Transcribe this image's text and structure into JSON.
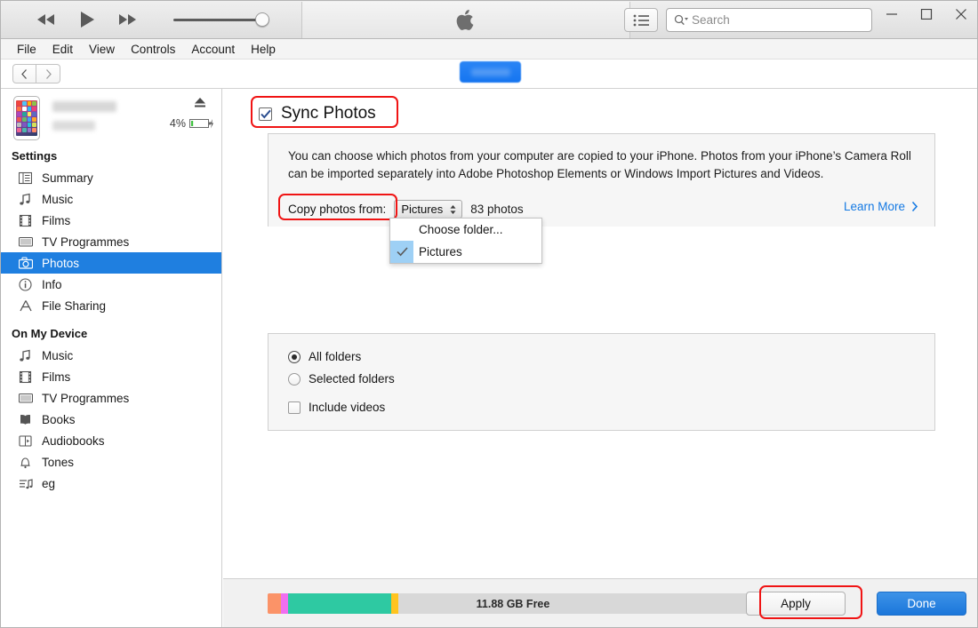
{
  "window": {
    "minimize_label": "—",
    "maximize_label": "□",
    "close_label": "✕"
  },
  "toolbar": {
    "rewind_icon": "rewind-icon",
    "play_icon": "play-icon",
    "fastforward_icon": "fast-forward-icon",
    "volume_icon": "volume-slider",
    "airplay_icon": "airplay-icon",
    "apple_logo_icon": "apple-logo-icon",
    "list_view_icon": "list-view-icon",
    "search_icon": "search-icon",
    "search_placeholder": "Search",
    "search_value": ""
  },
  "menubar": {
    "items": [
      {
        "label": "File"
      },
      {
        "label": "Edit"
      },
      {
        "label": "View"
      },
      {
        "label": "Controls"
      },
      {
        "label": "Account"
      },
      {
        "label": "Help"
      }
    ]
  },
  "navstrip": {
    "back_icon": "chevron-left-icon",
    "forward_icon": "chevron-right-icon",
    "tab_pill_label": ""
  },
  "sidebar": {
    "device": {
      "thumbnail_icon": "iphone-thumbnail-icon",
      "name": "",
      "subtitle": "",
      "eject_icon": "eject-icon",
      "battery_percent": "4%",
      "battery_icon": "battery-icon",
      "charging_icon": "lightning-bolt-icon"
    },
    "settings_heading": "Settings",
    "settings_items": [
      {
        "label": "Summary",
        "icon": "summary-icon",
        "active": false
      },
      {
        "label": "Music",
        "icon": "music-note-icon",
        "active": false
      },
      {
        "label": "Films",
        "icon": "film-strip-icon",
        "active": false
      },
      {
        "label": "TV Programmes",
        "icon": "tv-icon",
        "active": false
      },
      {
        "label": "Photos",
        "icon": "camera-icon",
        "active": true
      },
      {
        "label": "Info",
        "icon": "info-circle-icon",
        "active": false
      },
      {
        "label": "File Sharing",
        "icon": "file-sharing-icon",
        "active": false
      }
    ],
    "on_my_device_heading": "On My Device",
    "on_my_device_items": [
      {
        "label": "Music",
        "icon": "music-note-icon"
      },
      {
        "label": "Films",
        "icon": "film-strip-icon"
      },
      {
        "label": "TV Programmes",
        "icon": "tv-icon"
      },
      {
        "label": "Books",
        "icon": "books-icon"
      },
      {
        "label": "Audiobooks",
        "icon": "audiobook-icon"
      },
      {
        "label": "Tones",
        "icon": "bell-icon"
      },
      {
        "label": "eg",
        "icon": "playlist-icon"
      }
    ]
  },
  "main": {
    "sync_photos_label": "Sync Photos",
    "sync_photos_checked": true,
    "description": "You can choose which photos from your computer are copied to your iPhone. Photos from your iPhone’s Camera Roll can be imported separately into Adobe Photoshop Elements or Windows Import Pictures and Videos.",
    "copy_photos_from_label": "Copy photos from:",
    "source_selected": "Pictures",
    "photo_count": "83 photos",
    "learn_more_label": "Learn More",
    "learn_more_icon": "chevron-right-icon",
    "dropdown": {
      "open": true,
      "options": [
        {
          "label": "Choose folder...",
          "checked": false
        },
        {
          "label": "Pictures",
          "checked": true
        }
      ]
    },
    "folder_options": [
      {
        "label": "All folders",
        "selected": true
      },
      {
        "label": "Selected folders",
        "selected": false
      }
    ],
    "include_videos_label": "Include videos",
    "include_videos_checked": false
  },
  "footer": {
    "capacity_free_label": "11.88 GB Free",
    "capacity_segments": [
      {
        "name": "photos",
        "color": "#fb9368",
        "width_pct": 2.7
      },
      {
        "name": "apps",
        "color": "#f06ef0",
        "width_pct": 1.4
      },
      {
        "name": "audio",
        "color": "#2ec9a2",
        "width_pct": 21.0
      },
      {
        "name": "other",
        "color": "#ffc41f",
        "width_pct": 1.6
      },
      {
        "name": "free",
        "color": "#d8d8d8",
        "width_pct": 73.3
      }
    ],
    "apply_label": "Apply",
    "done_label": "Done"
  },
  "annotations": {
    "highlight_color": "#f01414",
    "boxes": [
      {
        "name": "sync-photos-highlight"
      },
      {
        "name": "copy-photos-from-highlight"
      },
      {
        "name": "apply-button-highlight"
      }
    ]
  }
}
